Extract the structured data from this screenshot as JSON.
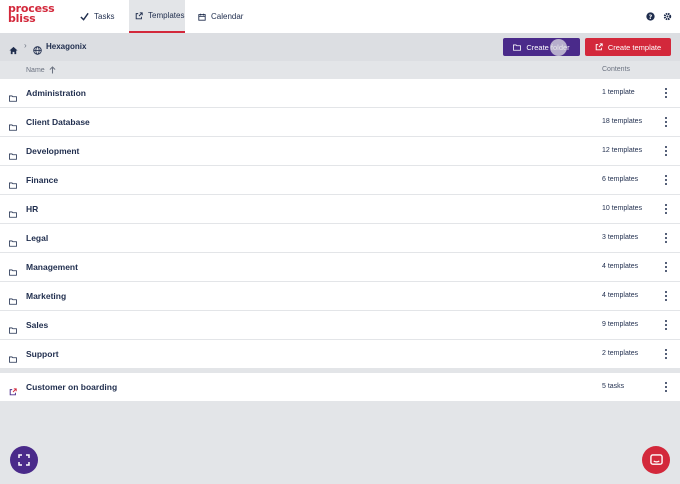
{
  "app": {
    "logo_line1": "process",
    "logo_line2": "bliss"
  },
  "nav": {
    "tabs": [
      {
        "label": "Tasks",
        "icon": "check-icon"
      },
      {
        "label": "Templates",
        "icon": "template-icon",
        "active": true
      },
      {
        "label": "Calendar",
        "icon": "calendar-icon"
      }
    ],
    "right_icons": [
      "help-icon",
      "gear-icon"
    ]
  },
  "breadcrumb": {
    "items": [
      {
        "icon": "home-icon"
      },
      {
        "label": "Hexagonix",
        "icon": "globe-icon"
      }
    ]
  },
  "toolbar": {
    "create_folder_label": "Create folder",
    "create_template_label": "Create template"
  },
  "table": {
    "col_name": "Name",
    "col_contents": "Contents",
    "folders": [
      {
        "name": "Administration",
        "contents": "1 template"
      },
      {
        "name": "Client Database",
        "contents": "18 templates"
      },
      {
        "name": "Development",
        "contents": "12 templates"
      },
      {
        "name": "Finance",
        "contents": "6 templates"
      },
      {
        "name": "HR",
        "contents": "10 templates"
      },
      {
        "name": "Legal",
        "contents": "3 templates"
      },
      {
        "name": "Management",
        "contents": "4 templates"
      },
      {
        "name": "Marketing",
        "contents": "4 templates"
      },
      {
        "name": "Sales",
        "contents": "9 templates"
      },
      {
        "name": "Support",
        "contents": "2 templates"
      }
    ],
    "templates": [
      {
        "name": "Customer on boarding",
        "contents": "5 tasks"
      }
    ]
  },
  "colors": {
    "brand_red": "#d3283b",
    "brand_purple": "#4a2a8a",
    "text_navy": "#1f2d4d",
    "background": "#e3e5e8"
  }
}
